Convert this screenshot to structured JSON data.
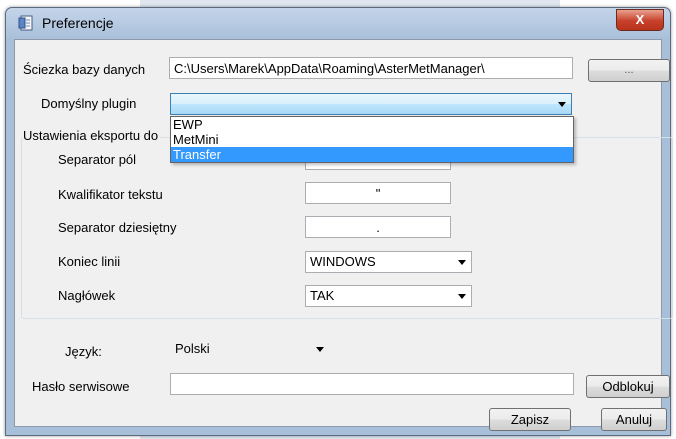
{
  "window": {
    "title": "Preferencje",
    "close_glyph": "X"
  },
  "db_path": {
    "label": "Ściezka bazy danych",
    "value": "C:\\Users\\Marek\\AppData\\Roaming\\AsterMetManager\\",
    "browse_label": "..."
  },
  "plugin": {
    "label": "Domyślny plugin",
    "value": "",
    "options": [
      "EWP",
      "MetMini",
      "Transfer"
    ],
    "highlighted": "Transfer"
  },
  "export": {
    "group_label": "Ustawienia eksportu do",
    "field_separator": {
      "label": "Separator pól",
      "value": ""
    },
    "text_qualifier": {
      "label": "Kwalifikator tekstu",
      "value": "\""
    },
    "decimal_separator": {
      "label": "Separator dziesiętny",
      "value": "."
    },
    "line_end": {
      "label": "Koniec linii",
      "value": "WINDOWS"
    },
    "header": {
      "label": "Nagłówek",
      "value": "TAK"
    }
  },
  "language": {
    "label": "Język:",
    "value": "Polski"
  },
  "service_password": {
    "label": "Hasło serwisowe",
    "value": "",
    "unlock_label": "Odblokuj"
  },
  "actions": {
    "save_label": "Zapisz",
    "cancel_label": "Anuluj"
  },
  "icons": {
    "title": "preferences-document-icon",
    "dropdown": "chevron-down-icon",
    "close": "close-icon"
  }
}
